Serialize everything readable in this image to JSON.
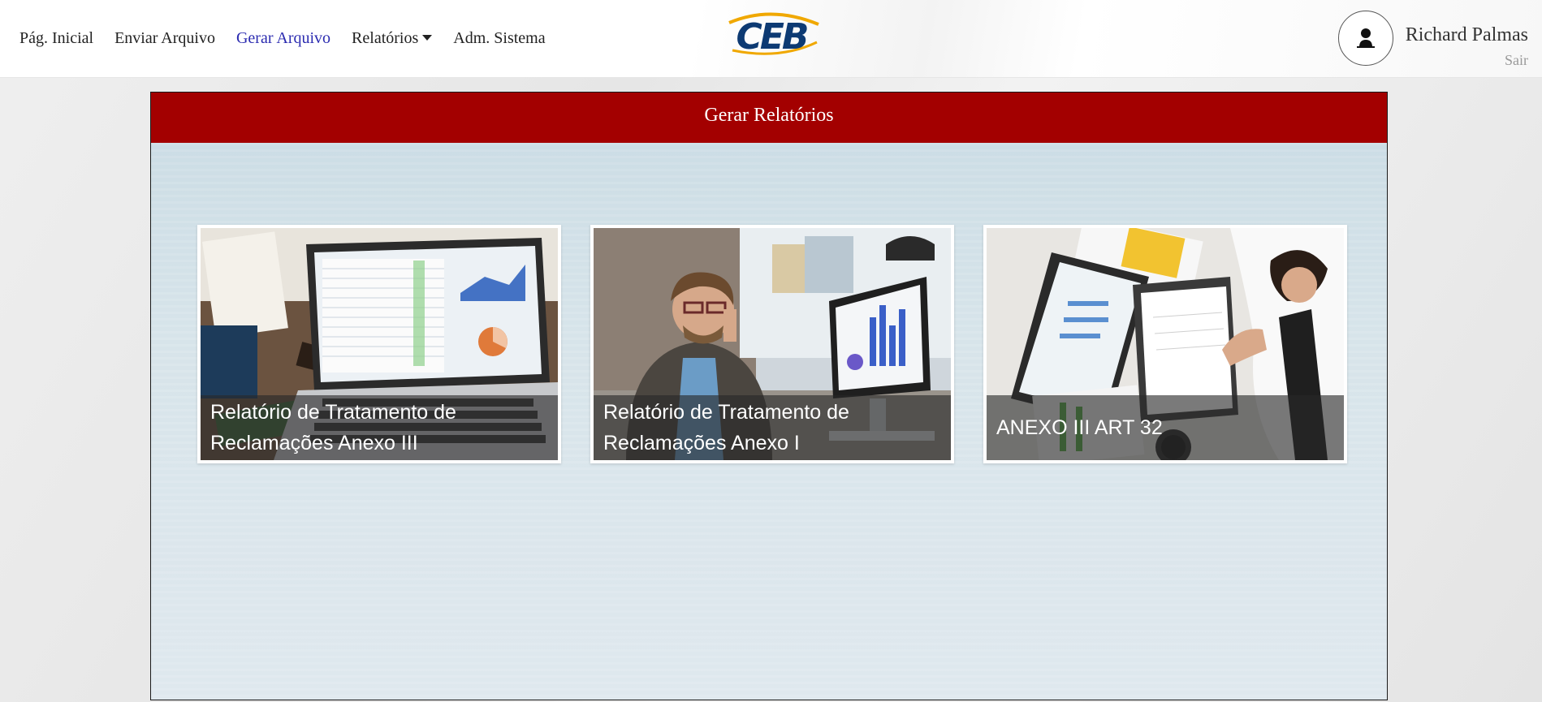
{
  "nav": {
    "items": [
      {
        "label": "Pág. Inicial",
        "active": false
      },
      {
        "label": "Enviar Arquivo",
        "active": false
      },
      {
        "label": "Gerar Arquivo",
        "active": true
      },
      {
        "label": "Relatórios",
        "active": false,
        "dropdown": true
      },
      {
        "label": "Adm. Sistema",
        "active": false
      }
    ],
    "logo_text": "CEB",
    "active_color": "#2b2bb0"
  },
  "user": {
    "name": "Richard Palmas",
    "logout_label": "Sair",
    "avatar_icon": "user-pin-icon"
  },
  "panel": {
    "title": "Gerar Relatórios",
    "header_color": "#a30000"
  },
  "cards": [
    {
      "caption": "Relatório de Tratamento de Reclamações Anexo III",
      "image": "laptop-spreadsheet-photo"
    },
    {
      "caption": "Relatório de Tratamento de Reclamações Anexo I",
      "image": "man-on-phone-photo"
    },
    {
      "caption": "ANEXO III ART 32",
      "image": "desk-documents-photo"
    }
  ]
}
